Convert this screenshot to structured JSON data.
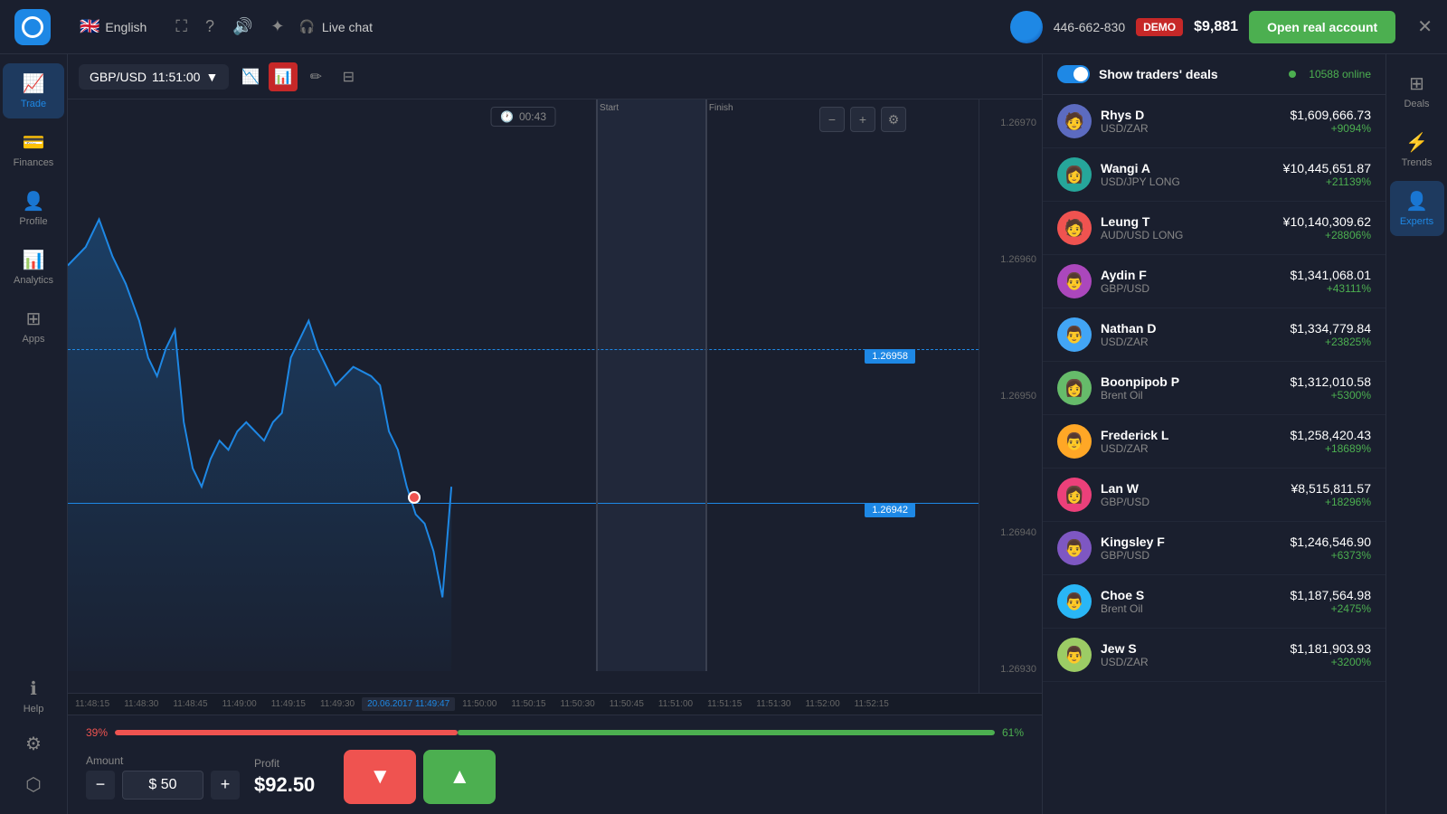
{
  "topbar": {
    "lang": "English",
    "flag": "🇬🇧",
    "live_chat": "Live chat",
    "user_id": "446-662-830",
    "demo": "DEMO",
    "balance": "$9,881",
    "open_account": "Open real account"
  },
  "sidebar": {
    "items": [
      {
        "label": "Trade",
        "icon": "📈",
        "active": true
      },
      {
        "label": "Finances",
        "icon": "💳",
        "active": false
      },
      {
        "label": "Profile",
        "icon": "👤",
        "active": false
      },
      {
        "label": "Analytics",
        "icon": "📊",
        "active": false
      },
      {
        "label": "Apps",
        "icon": "⊞",
        "active": false
      },
      {
        "label": "Help",
        "icon": "ℹ",
        "active": false
      }
    ],
    "bottom_items": [
      {
        "label": "",
        "icon": "⚙"
      },
      {
        "label": "",
        "icon": "⬡"
      }
    ]
  },
  "chart": {
    "pair": "GBP/USD",
    "time": "11:51:00",
    "timer": "00:43",
    "current_price": "1.26958",
    "price_line": "1.26942",
    "price_levels": [
      "1.26970",
      "1.26960",
      "1.26950",
      "1.26940",
      "1.26930"
    ],
    "times": [
      "11:48:15",
      "11:48:30",
      "11:48:45",
      "11:49:00",
      "11:49:15",
      "11:49:30",
      "20.06.2017 11:49:47",
      "11:50:00",
      "11:50:15",
      "11:50:30",
      "11:50:45",
      "11:51:00",
      "11:51:15",
      "11:51:30",
      "11:52:00",
      "11:52:15",
      "11:52:"
    ]
  },
  "trading": {
    "progress_left_pct": "39%",
    "progress_right_pct": "61%",
    "amount_label": "Amount",
    "amount_value": "$ 50",
    "profit_label": "Profit",
    "profit_value": "$92.50"
  },
  "traders_panel": {
    "title": "Show traders' deals",
    "online": "10588 online",
    "traders": [
      {
        "name": "Rhys D",
        "pair": "USD/ZAR",
        "amount": "$1,609,666.73",
        "pct": "+9094%",
        "avatar": "🧑"
      },
      {
        "name": "Wangi A",
        "pair": "USD/JPY LONG",
        "amount": "¥10,445,651.87",
        "pct": "+21139%",
        "avatar": "👩"
      },
      {
        "name": "Leung T",
        "pair": "AUD/USD LONG",
        "amount": "¥10,140,309.62",
        "pct": "+28806%",
        "avatar": "🧑"
      },
      {
        "name": "Aydin F",
        "pair": "GBP/USD",
        "amount": "$1,341,068.01",
        "pct": "+43111%",
        "avatar": "👨"
      },
      {
        "name": "Nathan D",
        "pair": "USD/ZAR",
        "amount": "$1,334,779.84",
        "pct": "+23825%",
        "avatar": "👨"
      },
      {
        "name": "Boonpipob P",
        "pair": "Brent Oil",
        "amount": "$1,312,010.58",
        "pct": "+5300%",
        "avatar": "👩"
      },
      {
        "name": "Frederick L",
        "pair": "USD/ZAR",
        "amount": "$1,258,420.43",
        "pct": "+18689%",
        "avatar": "👨"
      },
      {
        "name": "Lan W",
        "pair": "GBP/USD",
        "amount": "¥8,515,811.57",
        "pct": "+18296%",
        "avatar": "👩"
      },
      {
        "name": "Kingsley F",
        "pair": "GBP/USD",
        "amount": "$1,246,546.90",
        "pct": "+6373%",
        "avatar": "👨"
      },
      {
        "name": "Choe S",
        "pair": "Brent Oil",
        "amount": "$1,187,564.98",
        "pct": "+2475%",
        "avatar": "👨"
      },
      {
        "name": "Jew S",
        "pair": "USD/ZAR",
        "amount": "$1,181,903.93",
        "pct": "+3200%",
        "avatar": "👨"
      }
    ]
  },
  "right_sidebar": {
    "items": [
      {
        "label": "Deals",
        "icon": "⊞",
        "active": false
      },
      {
        "label": "Trends",
        "icon": "⚡",
        "active": false
      },
      {
        "label": "Experts",
        "icon": "👤",
        "active": true
      }
    ]
  }
}
